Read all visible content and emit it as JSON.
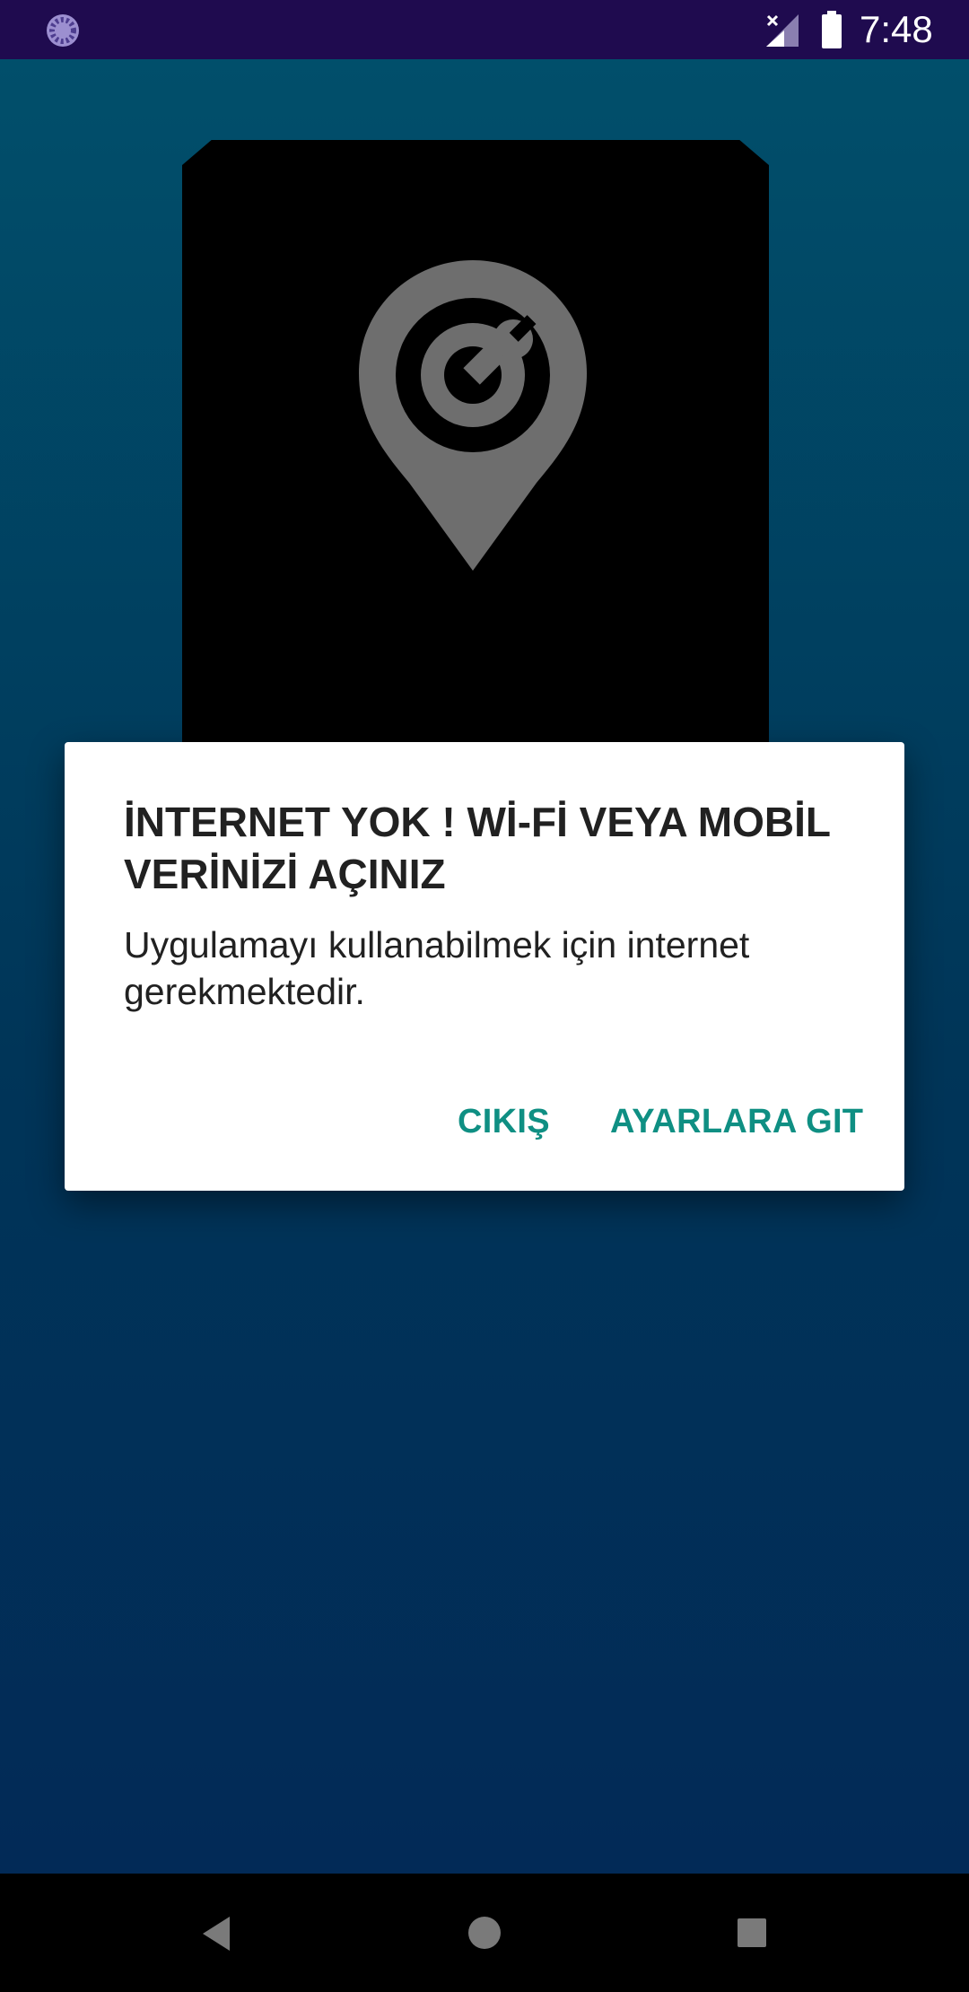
{
  "status_bar": {
    "time": "7:48",
    "icons": [
      "loading-icon",
      "signal-icon",
      "battery-icon"
    ]
  },
  "app": {
    "logo_icon": "map-pin-wrench-icon",
    "background_colors": [
      "#014f6b",
      "#003558",
      "#022a57"
    ]
  },
  "dialog": {
    "title": "İNTERNET YOK ! Wİ-Fİ VEYA MOBİL VERİNİZİ AÇINIZ",
    "message": "Uygulamayı kullanabilmek için internet gerekmektedir.",
    "exit_label": "CIKIŞ",
    "settings_label": "AYARLARA GIT",
    "accent_color": "#0f8f83"
  },
  "nav_bar": {
    "icons": [
      "back-icon",
      "home-icon",
      "recents-icon"
    ]
  }
}
